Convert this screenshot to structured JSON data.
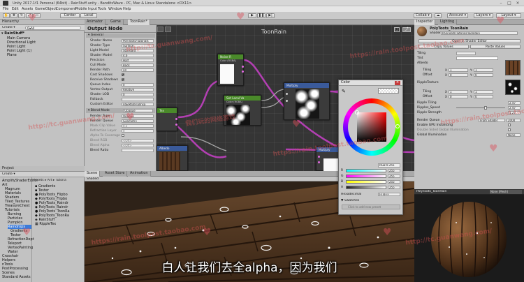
{
  "window": {
    "title": "Unity 2017.1f1 Personal (64bit) - RainStuff.unity - BanditsWave - PC, Mac & Linux Standalone <DX11>"
  },
  "menu": [
    "File",
    "Edit",
    "Assets",
    "GameObject",
    "Component",
    "Mobile Input",
    "Tools",
    "Window",
    "Help"
  ],
  "toolbar": {
    "pivot": "Center",
    "space": "Local",
    "collab": "Collab ▾",
    "account": "Account ▾",
    "layers": "Layers ▾",
    "layout": "Layout ▾"
  },
  "hierarchy": {
    "tab": "Hierarchy",
    "create": "Create ▾",
    "search": "Q▾All",
    "scene": "RainStuff*",
    "items": [
      "Main Camera",
      "Directional Light",
      "Point Light",
      "Point Light (1)",
      "Plane"
    ]
  },
  "project": {
    "tab": "Project",
    "create": "Create ▾",
    "breadcrumb": "Assets ▸ Art ▸ Tutoria",
    "tree": [
      "AmplifyShaderEditor",
      "Art",
      "Magnum",
      "Materials",
      "Shaders",
      "Tiled_Textures",
      "TreasureChest",
      "Tutorials",
      "Burning",
      "Particles",
      "Pumpkin",
      "Raindrops",
      "Gradients",
      "Tester",
      "RefractionDept",
      "Teleport",
      "VertexPainting",
      "Water",
      "Crosshair",
      "Helpers",
      "nTools",
      "PostProcessing",
      "Scenes",
      "Standard Assets"
    ],
    "files": [
      "Gradients",
      "Tester",
      "PolyToots_Flipbo",
      "PolyToots_Flipbo",
      "PolyToots_Raindr",
      "PolyToots_Raindr",
      "PolyToots_ToonRa",
      "PolyToots_ToonRa",
      "RainStuff",
      "RippleTex"
    ]
  },
  "amplify": {
    "tabs": [
      "Animator",
      "Game",
      "ToonRain*"
    ],
    "graph_title": "ToonRain",
    "output_node": {
      "title": "Output Node",
      "general": "General",
      "rows": [
        {
          "label": "Shader Name",
          "value": "PolyToots/Tutorials"
        },
        {
          "label": "Shader Type",
          "value": "Surface"
        },
        {
          "label": "Light Model",
          "value": "Standard"
        },
        {
          "label": "Shader Model",
          "value": "4.6"
        },
        {
          "label": "Precision",
          "value": "Half"
        },
        {
          "label": "Cull Mode",
          "value": "Back"
        },
        {
          "label": "Render Path",
          "value": "All"
        },
        {
          "label": "Cast Shadows",
          "value": ""
        },
        {
          "label": "Receive Shadows",
          "value": ""
        },
        {
          "label": "Queue Index",
          "value": "0"
        },
        {
          "label": "Vertex Output",
          "value": "Relative"
        },
        {
          "label": "Shader LOD",
          "value": "0"
        },
        {
          "label": "Fallback",
          "value": ""
        },
        {
          "label": "Custom Editor",
          "value": "ASEMaterialInsp"
        }
      ],
      "blend_mode": "Blend Mode",
      "blend_value": "Opaque",
      "blend_rows": [
        {
          "label": "Render Type",
          "value": "Opaque"
        },
        {
          "label": "Render Queue",
          "value": "Geometry"
        },
        {
          "label": "Mask Clip Value",
          "value": "0.5"
        },
        {
          "label": "Refraction Layer",
          "value": "0"
        },
        {
          "label": "Alpha To Coverage",
          "value": ""
        },
        {
          "label": "Blend RGB",
          "value": "<Off>"
        },
        {
          "label": "Blend Alpha",
          "value": "<Off>"
        },
        {
          "label": "Blend Ratio",
          "value": ""
        }
      ]
    },
    "nodes": [
      {
        "title": "Noise R",
        "sub": "Color (RGBA)"
      },
      {
        "title": "Set Local Va",
        "sub": "Color (RGBA)"
      },
      {
        "title": "Multiply"
      },
      {
        "title": "Tex"
      },
      {
        "title": "Albedo"
      },
      {
        "title": "Multiply"
      }
    ]
  },
  "colorpicker": {
    "title": "Color",
    "hex_mode": "RGB 0-255",
    "channels": [
      {
        "name": "R",
        "value": "255"
      },
      {
        "name": "G",
        "value": "255"
      },
      {
        "name": "B",
        "value": "255"
      },
      {
        "name": "A",
        "value": "255"
      }
    ],
    "hex_label": "Hexadecimal",
    "hex_value": "FFFFFF",
    "swatches": "▼ Swatches",
    "add_preset": "Click to add new preset"
  },
  "scene": {
    "tabs": [
      "Scene",
      "Asset Store",
      "Animation"
    ],
    "shading": "Shaded"
  },
  "inspector": {
    "tabs": [
      "Inspector",
      "Lighting"
    ],
    "material": "PolyToots_ToonRain",
    "shader_label": "Shader",
    "shader_value": "PolyToots/Tutorial/ToonRain",
    "open_editor": "Open in Shader Editor",
    "copy": "Copy Values",
    "paste": "Paste Values",
    "tiling": "Tiling",
    "tint": "Tint",
    "albedo": "Albedo",
    "tiling_x": "1",
    "tiling_y": "1",
    "offset": "Offset",
    "offset_x": "0",
    "offset_y": "0",
    "ripple_tex": "RippleTexture",
    "ripple_tiling": "Ripple Tiling",
    "ripples_speed": "Ripples_Speed",
    "ripple_strength": "Ripple Strength",
    "ripple_tiling_v": "2.47",
    "ripples_speed_v": "2.47",
    "ripple_strength_v": "1.27",
    "render_queue": "Render Queue",
    "render_queue_mode": "From Shader",
    "render_queue_v": "2000",
    "gpu": "Enable GPU Instancing",
    "double_sided": "Double Sided Global Illumination",
    "gi": "Global Illumination",
    "gi_v": "None"
  },
  "preview": {
    "name": "PolyToots_ToonRain",
    "mode": "None (Mesh)"
  },
  "subtitle": "白人让我们去全alpha，因为我们",
  "watermark": [
    "http://tc.guanwang.com/",
    "https://rain.toolpost.taobao.com",
    "http://tc.guanwang.com/",
    "https://rain.toolpost.taobao.com",
    "https://rain.toolpost.taobao.com",
    "我们玩的网络游戏",
    "https://rain.toolpost.taobao.com",
    "http://tc.guanwang.com/"
  ],
  "colors": {
    "accent": "#3d7bd8",
    "node_purple": "#b33fb3",
    "node_green": "#4a8a2a",
    "node_blue": "#3a5a9a"
  }
}
